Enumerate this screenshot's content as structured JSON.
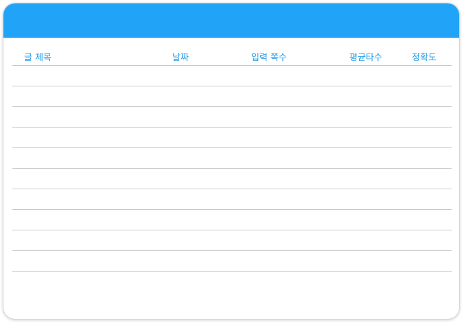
{
  "table": {
    "columns": {
      "title": "글 제목",
      "date": "날짜",
      "chars": "입력 쪽수",
      "speed": "평균타수",
      "accuracy": "정확도"
    },
    "rows": [
      {},
      {},
      {},
      {},
      {},
      {},
      {},
      {},
      {},
      {}
    ]
  },
  "colors": {
    "header_bar": "#21a4f7",
    "column_text": "#1f9be8",
    "row_divider": "#c9c9c9"
  }
}
